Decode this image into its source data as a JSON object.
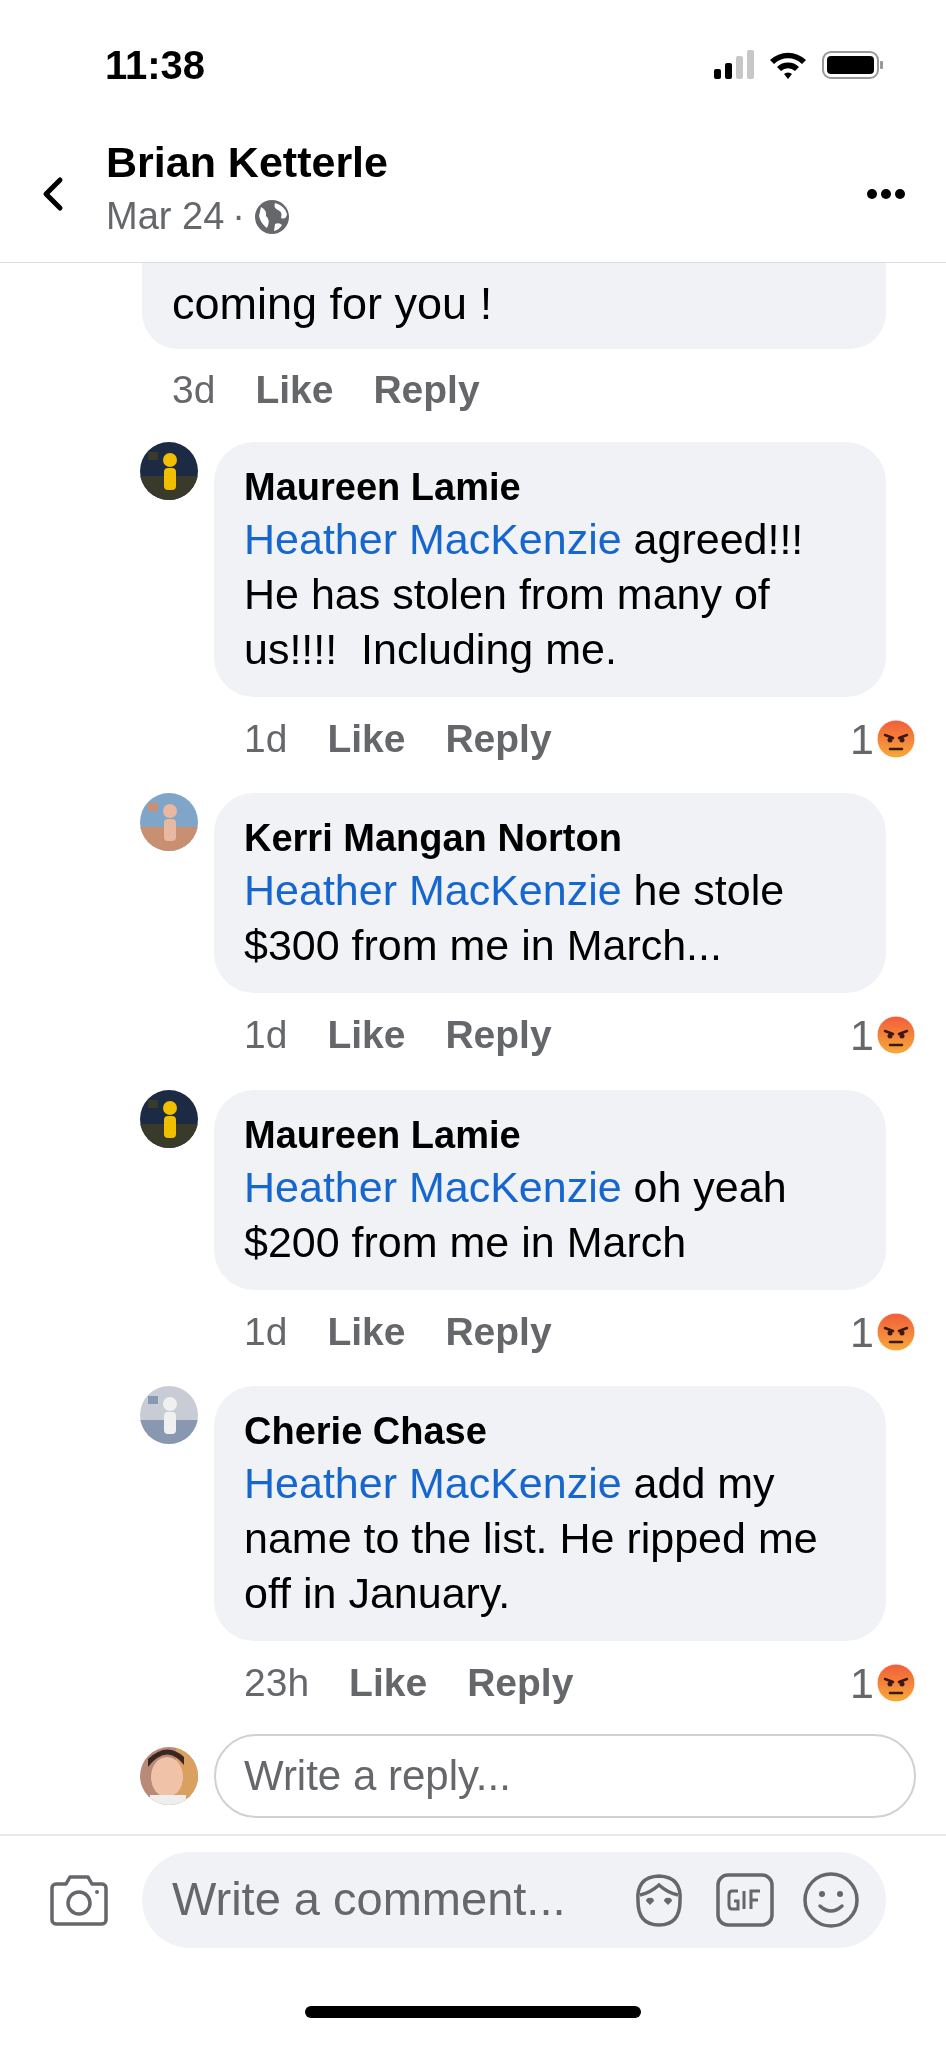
{
  "status_bar": {
    "time": "11:38"
  },
  "header": {
    "title": "Brian Ketterle",
    "date": "Mar 24",
    "separator": "·"
  },
  "comments": [
    {
      "kind": "partial",
      "text": "coming for you !",
      "time": "3d",
      "like": "Like",
      "reply": "Reply"
    },
    {
      "kind": "reply",
      "author": "Maureen Lamie",
      "mention": "Heather MacKenzie",
      "text": " agreed!!! He has stolen from many of us!!!!  Including me.",
      "time": "1d",
      "like": "Like",
      "reply": "Reply",
      "reaction_count": "1"
    },
    {
      "kind": "reply",
      "author": "Kerri Mangan Norton",
      "mention": "Heather MacKenzie",
      "text": " he stole $300 from me in March...",
      "time": "1d",
      "like": "Like",
      "reply": "Reply",
      "reaction_count": "1"
    },
    {
      "kind": "reply",
      "author": "Maureen Lamie",
      "mention": "Heather MacKenzie",
      "text": " oh yeah $200 from me in March",
      "time": "1d",
      "like": "Like",
      "reply": "Reply",
      "reaction_count": "1"
    },
    {
      "kind": "reply",
      "author": "Cherie Chase",
      "mention": "Heather MacKenzie",
      "text": " add my name to the list. He ripped me off in January.",
      "time": "23h",
      "like": "Like",
      "reply": "Reply",
      "reaction_count": "1"
    }
  ],
  "reply_field": {
    "placeholder": "Write a reply..."
  },
  "composer": {
    "placeholder": "Write a comment..."
  }
}
